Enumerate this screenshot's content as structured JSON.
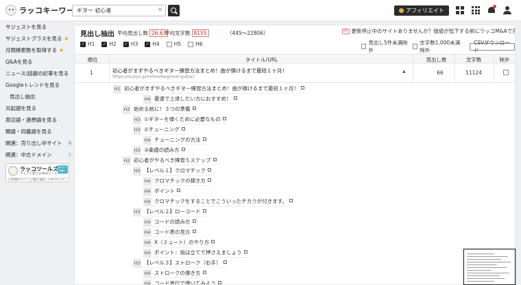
{
  "header": {
    "logo": "ラッコキーワード",
    "search_value": "ギター 初心者",
    "affiliate_label": "アフィリエイト"
  },
  "sidebar": {
    "items": [
      {
        "label": "サジェストを見る"
      },
      {
        "label": "サジェストプラスを見る",
        "star": "★"
      },
      {
        "label": "月間検索数を取得する",
        "star": "★"
      },
      {
        "label": "Q&Aを見る"
      },
      {
        "label": "ニュース/話題の記事を見る"
      },
      {
        "label": "Googleトレンドを見る"
      },
      {
        "label": "見出し抽出"
      },
      {
        "label": "共起語を見る"
      },
      {
        "label": "周辺語・連想語を見る"
      },
      {
        "label": "類語・同義語を見る"
      },
      {
        "label": "関連：売り出し中サイト",
        "badge": "S"
      },
      {
        "label": "関連：中古ドメイン",
        "badge": "i"
      }
    ],
    "banner": {
      "title": "ラッコツールズ",
      "subtitle": "ウェブと使えるWebツール",
      "free": "100ツール無料",
      "tags": [
        "文字数カウント",
        "見出し抽出",
        "SEOチェック"
      ]
    }
  },
  "main": {
    "title": "見出し抽出",
    "avg_headings_label": "平均見出し数",
    "avg_headings": "26.63",
    "avg_chars_label": "平均文字数",
    "avg_chars": "8155",
    "range": "（445〜22806）",
    "notice_pr": "PR",
    "notice": "更新停止中のサイトありませんか？価値が低下する前にラッコM&Aで売却！",
    "filters": [
      {
        "label": "H1",
        "checked": true
      },
      {
        "label": "H2",
        "checked": true
      },
      {
        "label": "H3",
        "checked": true
      },
      {
        "label": "H4",
        "checked": true
      },
      {
        "label": "H5",
        "checked": false
      },
      {
        "label": "H6",
        "checked": false
      }
    ],
    "opt_exclude_small": "見出し5件未満除外",
    "opt_exclude_chars": "文字数1,000未満除外",
    "csv_button": "CSVダウンロード",
    "columns": {
      "rank": "順位",
      "title": "タイトル/URL",
      "headings": "見出し数",
      "chars": "文字数",
      "exclude": "除外"
    },
    "row": {
      "rank": "1",
      "title": "初心者がまずやるべきギター練習方法まとめ！曲が弾けるまで最短１ヶ月！",
      "url": "https://muzyx.jp/online/beginner-guitar/",
      "headings": "66",
      "chars": "11124"
    },
    "outline": [
      {
        "tag": "H1",
        "text": "初心者がまずやるべきギター練習方法まとめ！曲が弾けるまで最短１ヶ月！"
      },
      {
        "tag": "H4",
        "text": "最速で上達したい方におすすめ！"
      },
      {
        "tag": "H2",
        "text": "始める前に！３つの準備"
      },
      {
        "tag": "H3",
        "text": "①ギターを弾くために必要なもの"
      },
      {
        "tag": "H3",
        "text": "②チューニング"
      },
      {
        "tag": "H4",
        "text": "チューニングの方法"
      },
      {
        "tag": "H3",
        "text": "③楽譜の読み方"
      },
      {
        "tag": "H2",
        "text": "初心者がやるべき練習５ステップ"
      },
      {
        "tag": "H3",
        "text": "【レベル１】クロマチック"
      },
      {
        "tag": "H4",
        "text": "クロマチックの弾き方"
      },
      {
        "tag": "H4",
        "text": "ポイント"
      },
      {
        "tag": "H4",
        "text": "クロマチックをすることでこういったチカラが付きます。"
      },
      {
        "tag": "H3",
        "text": "【レベル２】ローコード"
      },
      {
        "tag": "H4",
        "text": "コードの読み方"
      },
      {
        "tag": "H4",
        "text": "コード表の見方"
      },
      {
        "tag": "H4",
        "text": "X（ミュート）のやり方"
      },
      {
        "tag": "H4",
        "text": "ポイント：指は立てて押さえましょう"
      },
      {
        "tag": "H3",
        "text": "【レベル３】ストローク（右手）"
      },
      {
        "tag": "H4",
        "text": "ストロークの弾き方"
      },
      {
        "tag": "H4",
        "text": "コード進行で弾いてみよう"
      }
    ]
  }
}
